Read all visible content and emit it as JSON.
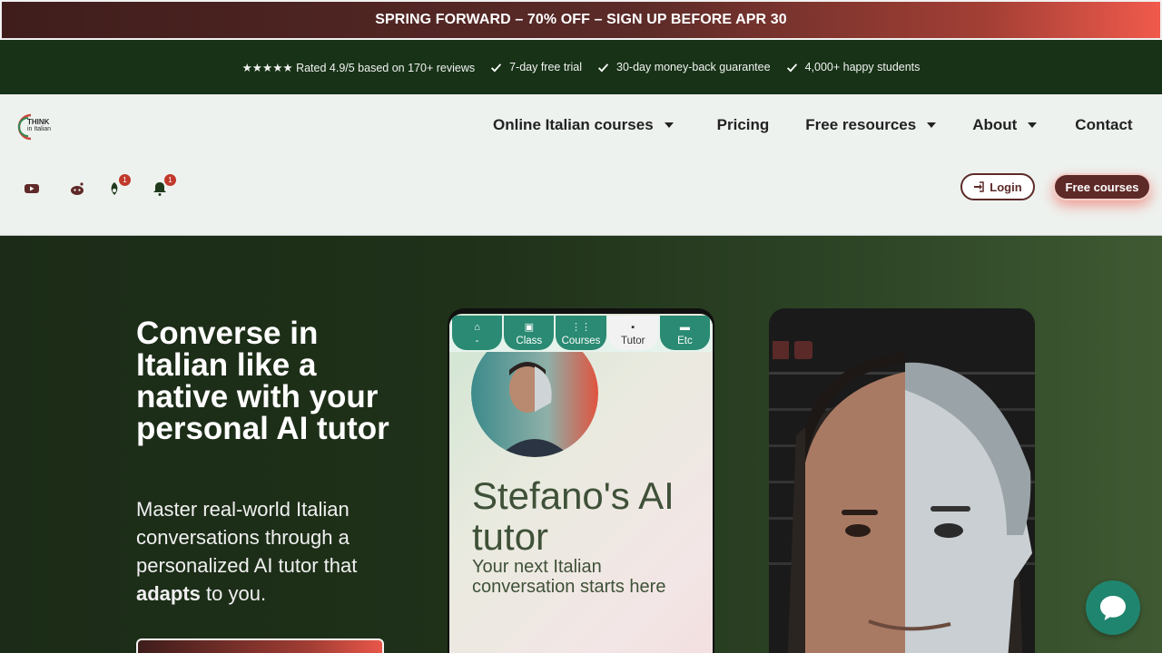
{
  "promo": {
    "text": "SPRING FORWARD – 70% OFF – SIGN UP BEFORE APR 30"
  },
  "trust": {
    "rating": "★★★★★ Rated 4.9/5 based on 170+ reviews",
    "items": [
      "7-day free trial",
      "30-day money-back guarantee",
      "4,000+ happy students"
    ]
  },
  "logo": {
    "line1": "THINK",
    "line2": "in Italian"
  },
  "nav": {
    "items": [
      "Online Italian courses",
      "Pricing",
      "Free resources",
      "About",
      "Contact"
    ]
  },
  "social": {
    "icons": [
      "youtube-icon",
      "reddit-icon",
      "leaf-icon",
      "bell-icon"
    ],
    "badges": [
      "1",
      "1"
    ]
  },
  "header_buttons": {
    "login": "Login",
    "free_courses": "Free courses"
  },
  "hero": {
    "title": "Converse in Italian like a native with your personal AI tutor",
    "subtitle_pre": "Master real-world Italian conversations through a personalized AI tutor that ",
    "subtitle_bold": "adapts",
    "subtitle_post": " to you."
  },
  "phone": {
    "tabs": [
      {
        "icon": "home-icon",
        "label": "-"
      },
      {
        "icon": "class-icon",
        "label": "Class"
      },
      {
        "icon": "courses-icon",
        "label": "Courses"
      },
      {
        "icon": "robot-icon",
        "label": "Tutor"
      },
      {
        "icon": "folder-icon",
        "label": "Etc"
      }
    ],
    "title": "Stefano's AI tutor",
    "subtitle": "Your next Italian conversation starts here"
  },
  "colors": {
    "accent": "#5e2a27",
    "green_dark": "#173216",
    "teal": "#20856f"
  }
}
